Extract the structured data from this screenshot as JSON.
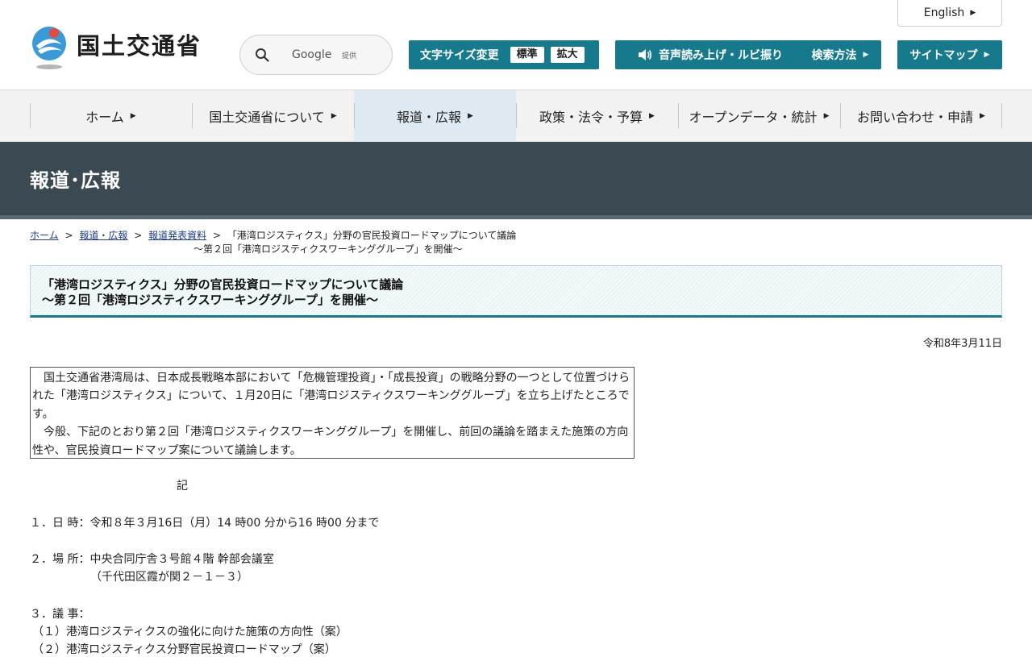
{
  "header": {
    "logo_text": "国土交通省",
    "english_label": "English",
    "search": {
      "placeholder": "Google",
      "provided_by": "提供"
    },
    "font_size": {
      "label": "文字サイズ変更",
      "standard": "標準",
      "large": "拡大"
    },
    "voice_label": "音声読み上げ・ルビ振り",
    "search_how_label": "検索方法",
    "sitemap_label": "サイトマップ"
  },
  "nav": {
    "items": [
      {
        "label": "ホーム"
      },
      {
        "label": "国土交通省について"
      },
      {
        "label": "報道・広報"
      },
      {
        "label": "政策・法令・予算"
      },
      {
        "label": "オープンデータ・統計"
      },
      {
        "label": "お問い合わせ・申請"
      }
    ],
    "active_index": 2
  },
  "banner": {
    "title": "報道･広報"
  },
  "breadcrumb": {
    "home": "ホーム",
    "press": "報道・広報",
    "press_release": "報道発表資料",
    "current_line1": "「港湾ロジスティクス」分野の官民投資ロードマップについて議論",
    "current_line2": "～第２回「港湾ロジスティクスワーキンググループ」を開催～",
    "separator": ">"
  },
  "article": {
    "title_line1": "「港湾ロジスティクス」分野の官民投資ロードマップについて議論",
    "title_line2": "～第２回「港湾ロジスティクスワーキンググループ」を開催～",
    "date": "令和8年3月11日",
    "lead_p1": "国土交通省港湾局は、日本成長戦略本部において「危機管理投資」・「成長投資」の戦略分野の一つとして位置づけられた「港湾ロジスティクス」について、１月20日に「港湾ロジスティクスワーキンググループ」を立ち上げたところです。",
    "lead_p2": "今般、下記のとおり第２回「港湾ロジスティクスワーキンググループ」を開催し、前回の議論を踏まえた施策の方向性や、官民投資ロードマップ案について議論します。",
    "ki": "記",
    "item1": "１．日 時：令和８年３月16日（月）14 時00 分から16 時00 分まで",
    "item2": "２．場 所：中央合同庁舎３号館４階 幹部会議室",
    "item2_sub": "（千代田区霞が関２－１－３）",
    "item3": "３．議 事：",
    "item3_1": "（１）港湾ロジスティクスの強化に向けた施策の方向性（案）",
    "item3_2": "（２）港湾ロジスティクス分野官民投資ロードマップ（案）"
  },
  "colors": {
    "accent": "#177a8c",
    "banner": "#3b4a52",
    "nav_active": "#dfe9f2"
  }
}
